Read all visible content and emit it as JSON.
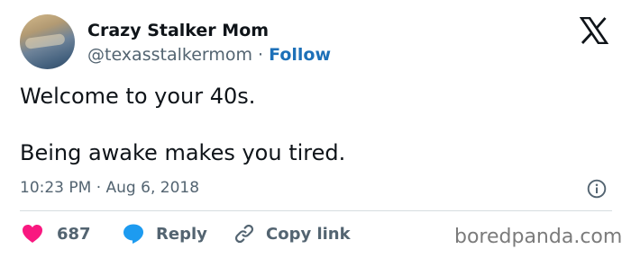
{
  "author": {
    "name": "Crazy Stalker Mom",
    "handle": "@texasstalkermom",
    "separator": "·",
    "follow_label": "Follow"
  },
  "tweet": {
    "line1": "Welcome to your 40s.",
    "line2": "Being awake makes you tired.",
    "timestamp": "10:23 PM · Aug 6, 2018"
  },
  "actions": {
    "likes_count": "687",
    "reply_label": "Reply",
    "copy_link_label": "Copy link"
  },
  "icons": {
    "platform": "x-logo-icon",
    "info": "info-icon",
    "like": "heart-icon",
    "reply": "speech-bubble-icon",
    "copy": "link-icon"
  },
  "colors": {
    "like": "#f91880",
    "reply": "#1d9bf0",
    "follow": "#1d70b8",
    "muted": "#536471"
  },
  "watermark": "boredpanda.com"
}
